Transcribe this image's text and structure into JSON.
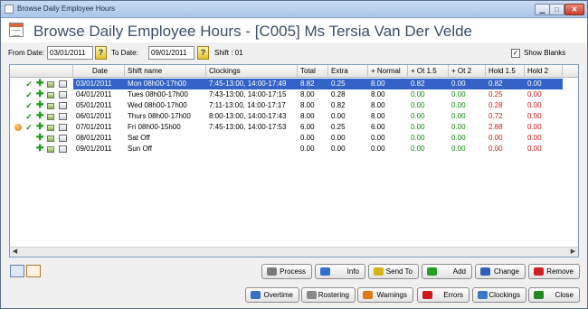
{
  "window": {
    "title": "Browse Daily Employee Hours"
  },
  "header": {
    "heading": "Browse Daily Employee Hours - [C005] Ms Tersia Van Der Velde"
  },
  "filter": {
    "from_label": "From Date:",
    "from_value": "03/01/2011",
    "to_label": "To Date:",
    "to_value": "09/01/2011",
    "shift_label": "Shift : 01",
    "show_blanks_label": "Show Blanks",
    "show_blanks_checked": true
  },
  "columns": [
    "Date",
    "Shift name",
    "Clockings",
    "Total",
    "Extra",
    "+ Normal",
    "+ Ot 1.5",
    "+ Ot 2",
    "Hold 1.5",
    "Hold 2"
  ],
  "rows": [
    {
      "icons": [
        "check",
        "plus",
        "edit",
        "calendar"
      ],
      "date": "03/01/2011",
      "shift": "Mon 08h00-17h00",
      "clockings": "7:45-13:00, 14:00-17:49",
      "total": "8.82",
      "extra": "0.25",
      "normal": "8.00",
      "ot15": "0.82",
      "ot2": "0.00",
      "hold15": "0.82",
      "hold2": "0.00",
      "selected": true
    },
    {
      "icons": [
        "check",
        "plus",
        "edit",
        "calendar"
      ],
      "date": "04/01/2011",
      "shift": "Tues 08h00-17h00",
      "clockings": "7:43-13:00, 14:00-17:15",
      "total": "8.00",
      "extra": "0.28",
      "normal": "8.00",
      "ot15": "0.00",
      "ot2": "0.00",
      "hold15": "0.25",
      "hold2": "0.00"
    },
    {
      "icons": [
        "check",
        "plus",
        "edit",
        "calendar"
      ],
      "date": "05/01/2011",
      "shift": "Wed 08h00-17h00",
      "clockings": "7:11-13:00, 14:00-17:17",
      "total": "8.00",
      "extra": "0.82",
      "normal": "8.00",
      "ot15": "0.00",
      "ot2": "0.00",
      "hold15": "0.28",
      "hold2": "0.00"
    },
    {
      "icons": [
        "check",
        "plus",
        "edit",
        "calendar"
      ],
      "date": "06/01/2011",
      "shift": "Thurs 08h00-17h00",
      "clockings": "8:00-13:00, 14:00-17:43",
      "total": "8.00",
      "extra": "0.00",
      "normal": "8.00",
      "ot15": "0.00",
      "ot2": "0.00",
      "hold15": "0.72",
      "hold2": "0.00"
    },
    {
      "icons": [
        "warning-dot",
        "check",
        "plus",
        "edit",
        "calendar"
      ],
      "date": "07/01/2011",
      "shift": "Fri 08h00-15h00",
      "clockings": "7:45-13:00, 14:00-17:53",
      "total": "6.00",
      "extra": "0.25",
      "normal": "6.00",
      "ot15": "0.00",
      "ot2": "0.00",
      "hold15": "2.88",
      "hold2": "0.00"
    },
    {
      "icons": [
        "plus",
        "edit",
        "calendar"
      ],
      "date": "08/01/2011",
      "shift": "Sat Off",
      "clockings": "",
      "total": "0.00",
      "extra": "0.00",
      "normal": "0.00",
      "ot15": "0.00",
      "ot2": "0.00",
      "hold15": "0.00",
      "hold2": "0.00"
    },
    {
      "icons": [
        "plus",
        "edit",
        "calendar"
      ],
      "date": "09/01/2011",
      "shift": "Sun Off",
      "clockings": "",
      "total": "0.00",
      "extra": "0.00",
      "normal": "0.00",
      "ot15": "0.00",
      "ot2": "0.00",
      "hold15": "0.00",
      "hold2": "0.00"
    }
  ],
  "buttons_row1": [
    {
      "name": "process",
      "label": "Process",
      "icon": "process-icon",
      "color": "#7a7a7a"
    },
    {
      "name": "info",
      "label": "Info",
      "icon": "info-icon",
      "color": "#2f6fd0"
    },
    {
      "name": "send-to",
      "label": "Send To",
      "icon": "send-icon",
      "color": "#d9b21c"
    },
    {
      "name": "add",
      "label": "Add",
      "icon": "add-icon",
      "color": "#22a022"
    },
    {
      "name": "change",
      "label": "Change",
      "icon": "change-icon",
      "color": "#2f5fc0"
    },
    {
      "name": "remove",
      "label": "Remove",
      "icon": "remove-icon",
      "color": "#d02020"
    }
  ],
  "buttons_row2": [
    {
      "name": "overtime",
      "label": "Overtime",
      "icon": "overtime-icon",
      "color": "#3a6fc8"
    },
    {
      "name": "rostering",
      "label": "Rostering",
      "icon": "rostering-icon",
      "color": "#888888"
    },
    {
      "name": "warnings",
      "label": "Warnings",
      "icon": "warnings-icon",
      "color": "#e07a10"
    },
    {
      "name": "errors",
      "label": "Errors",
      "icon": "errors-icon",
      "color": "#d01818"
    },
    {
      "name": "clockings",
      "label": "Clockings",
      "icon": "clockings-icon",
      "color": "#3a78c8"
    },
    {
      "name": "close",
      "label": "Close",
      "icon": "close-check-icon",
      "color": "#1d8a1d"
    }
  ],
  "colors": {
    "selection": "#3363c6",
    "positive": "#148a14",
    "negative": "#d01818"
  }
}
